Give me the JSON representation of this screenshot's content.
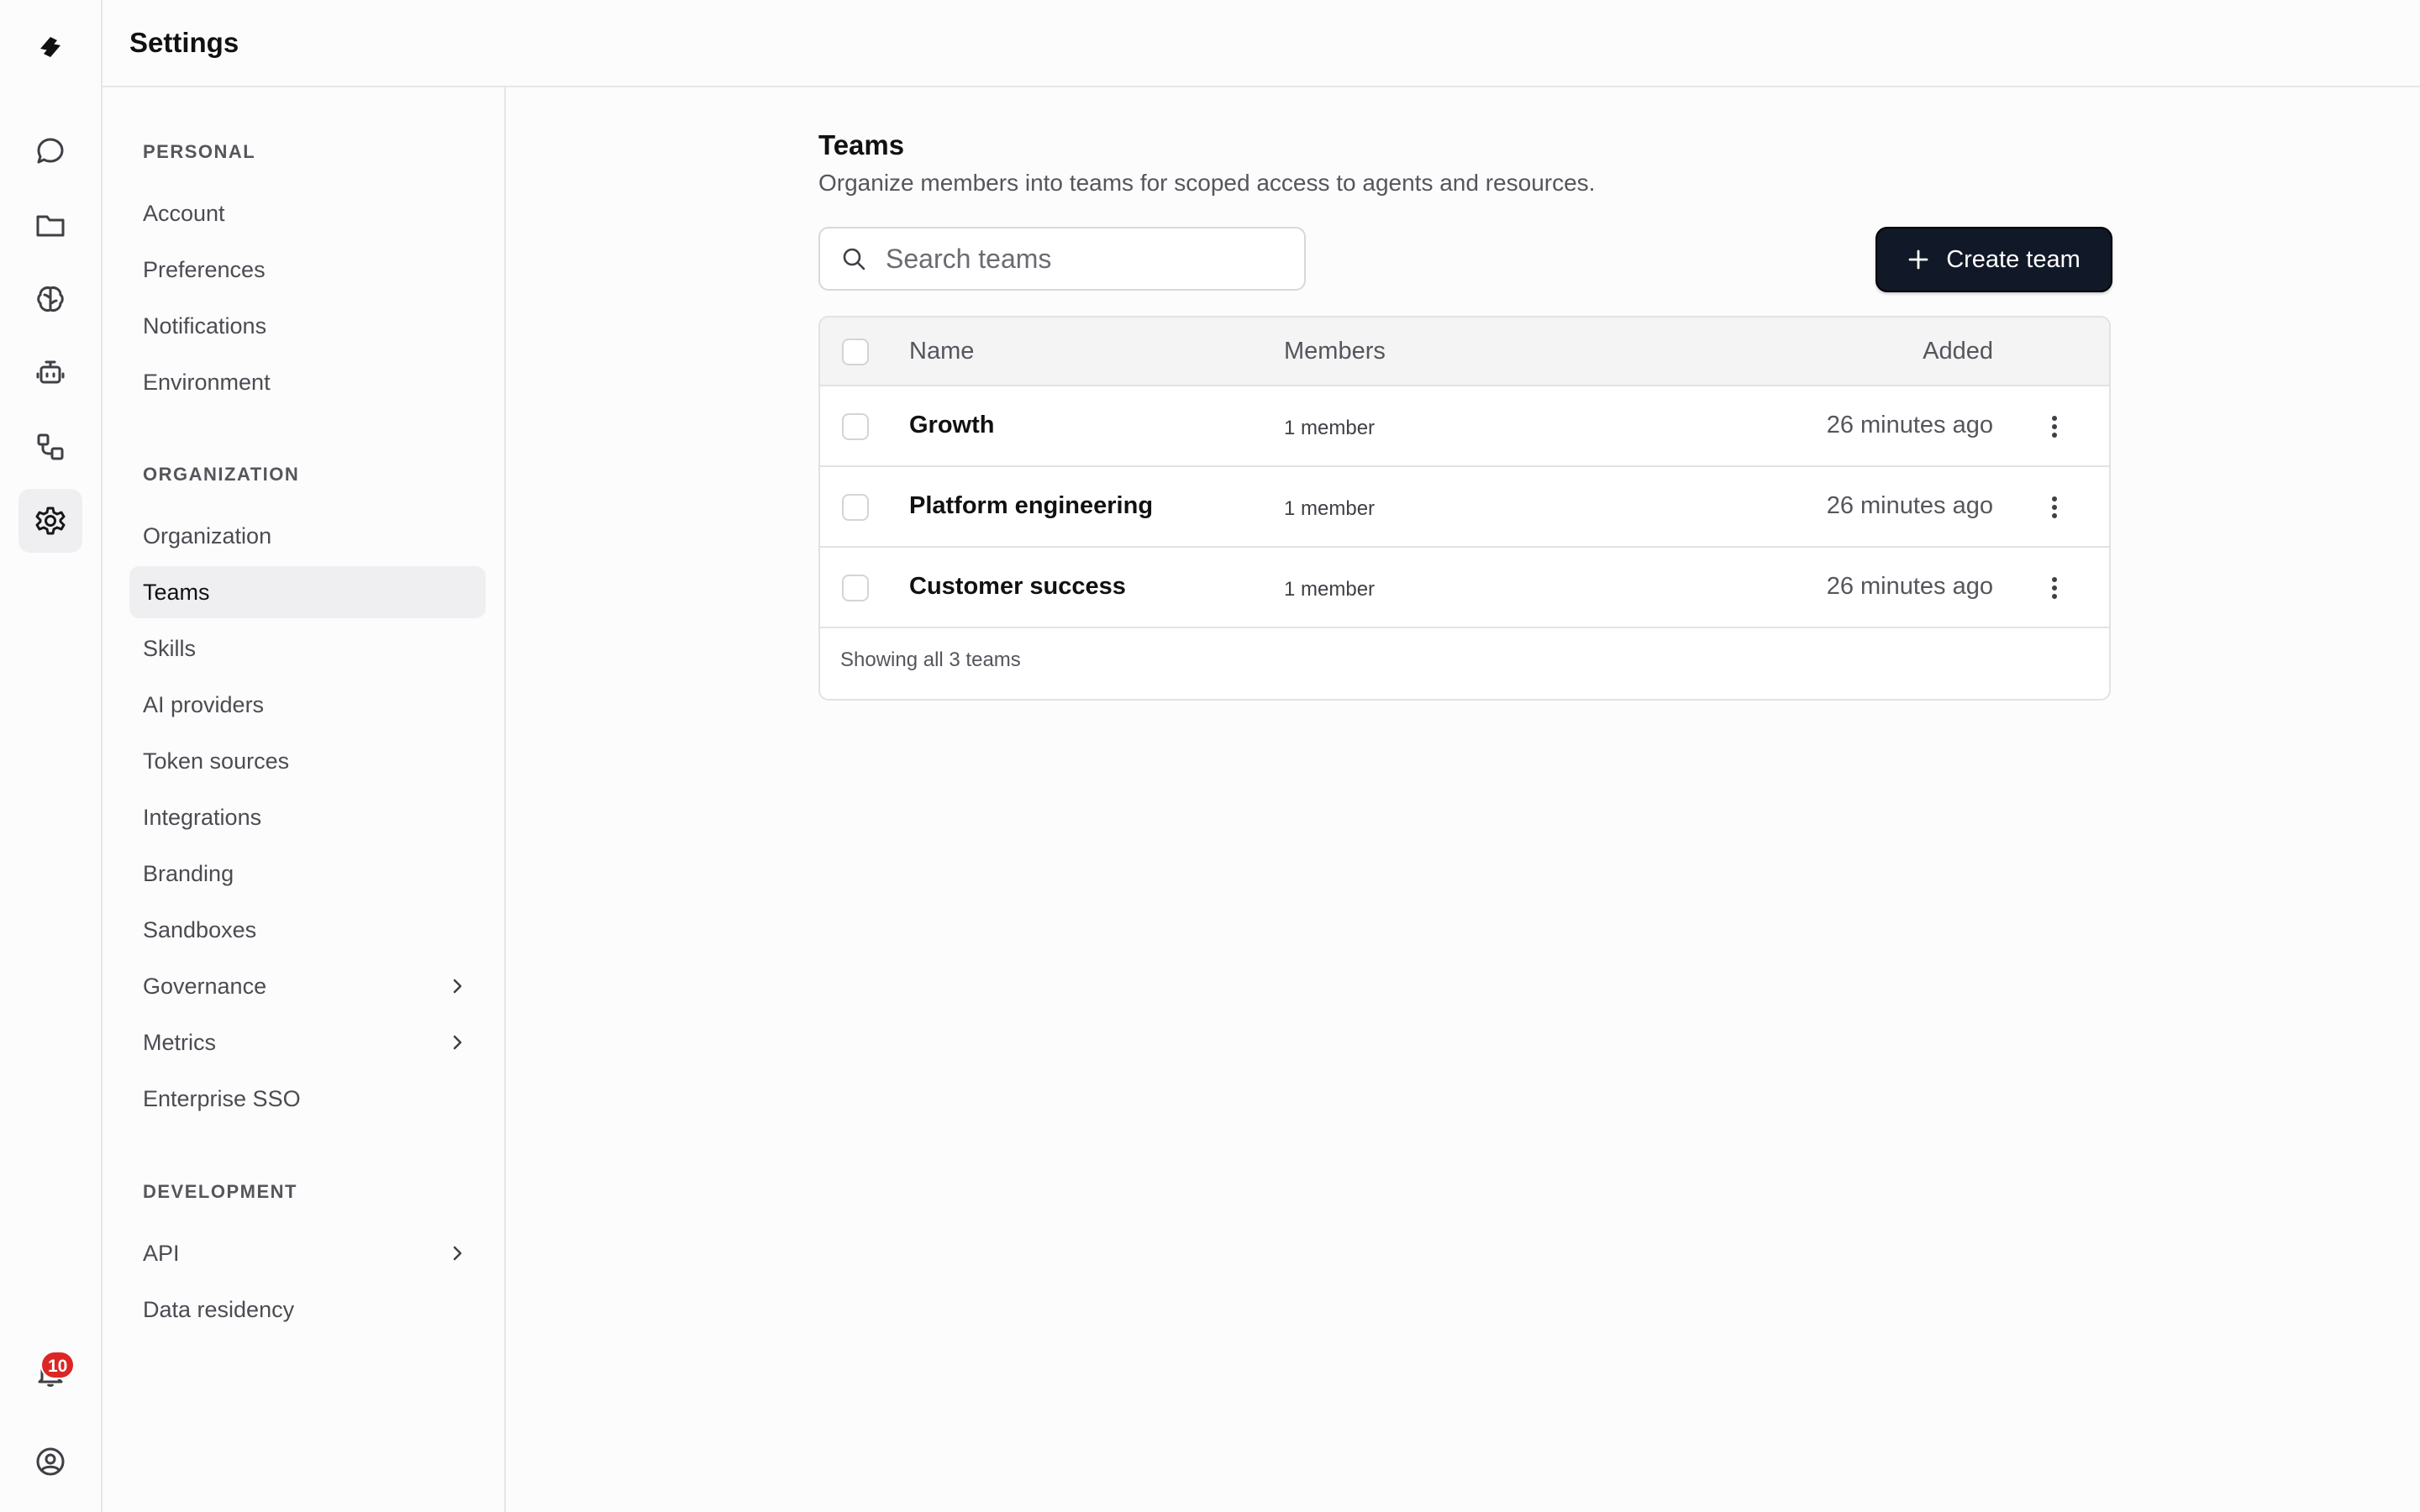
{
  "header": {
    "title": "Settings"
  },
  "rail": {
    "items": [
      {
        "icon": "logo-icon"
      },
      {
        "icon": "chat-icon"
      },
      {
        "icon": "folder-icon"
      },
      {
        "icon": "brain-icon"
      },
      {
        "icon": "bot-icon"
      },
      {
        "icon": "workflow-icon"
      },
      {
        "icon": "gear-icon",
        "active": true
      },
      {
        "icon": "bell-icon"
      },
      {
        "icon": "user-circle-icon"
      }
    ],
    "notifications_count": "10",
    "badge_color": "#dc2626"
  },
  "nav": {
    "personal": {
      "heading": "PERSONAL",
      "items": [
        "Account",
        "Preferences",
        "Notifications",
        "Environment"
      ]
    },
    "organization": {
      "heading": "ORGANIZATION",
      "items": [
        "Organization",
        "Teams",
        "Skills",
        "AI providers",
        "Token sources",
        "Integrations",
        "Branding",
        "Sandboxes",
        "Governance",
        "Metrics",
        "Enterprise SSO"
      ],
      "active": "Teams"
    },
    "development": {
      "heading": "DEVELOPMENT",
      "items": [
        "API",
        "Data residency"
      ]
    }
  },
  "main": {
    "title": "Teams",
    "subtitle": "Organize members into teams for scoped access to agents and resources.",
    "search_placeholder": "Search teams",
    "create_label": "Create team",
    "columns": {
      "name": "Name",
      "members": "Members",
      "added": "Added"
    },
    "rows": [
      {
        "name": "Growth",
        "members": "1 member",
        "added": "26 minutes ago"
      },
      {
        "name": "Platform engineering",
        "members": "1 member",
        "added": "26 minutes ago"
      },
      {
        "name": "Customer success",
        "members": "1 member",
        "added": "26 minutes ago"
      }
    ],
    "footer": "Showing all 3 teams"
  },
  "colors": {
    "primary_button": "#111827",
    "active_nav_bg": "#efeff1"
  }
}
